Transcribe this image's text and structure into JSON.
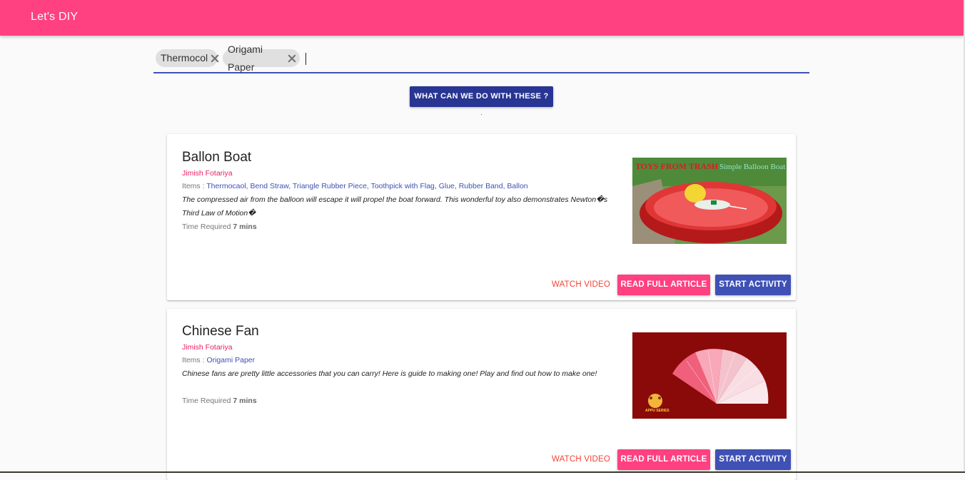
{
  "app": {
    "title": "Let's DIY"
  },
  "search": {
    "chips": [
      {
        "label": "Thermocol"
      },
      {
        "label": "Origami Paper"
      }
    ],
    "submit_label": "WHAT CAN WE DO WITH THESE ?"
  },
  "cards": [
    {
      "title": "Ballon Boat",
      "author": "Jimish Fotariya",
      "items_label": "Items : ",
      "items": "Thermocaol, Bend Straw, Triangle Rubber Piece, Toothpick with Flag, Glue, Rubber Band, Ballon",
      "description": "The compressed air from the balloon will escape it will propel the boat forward. This wonderful toy also demonstrates Newton�s Third Law of Motion�",
      "time_label": "Time Required ",
      "time_value": "7 mins",
      "thumbnail_text_left": "TOYS FROM TRASH",
      "thumbnail_text_right": "Simple Balloon Boat",
      "watch_label": "WATCH VIDEO",
      "read_label": "READ FULL ARTICLE",
      "start_label": "START ACTIVITY"
    },
    {
      "title": "Chinese Fan",
      "author": "Jimish Fotariya",
      "items_label": "Items : ",
      "items": "Origami Paper",
      "description": "Chinese fans are pretty little accessories that you can carry! Here is guide to making one! Play and find out how to make one!",
      "time_label": "Time Required ",
      "time_value": "7 mins",
      "thumbnail_badge": "APPU SERIES",
      "watch_label": "WATCH VIDEO",
      "read_label": "READ FULL ARTICLE",
      "start_label": "START ACTIVITY"
    }
  ],
  "colors": {
    "primary": "#3f51b5",
    "accent": "#ff4081",
    "button_dark": "#283593",
    "link_red": "#f44336"
  }
}
